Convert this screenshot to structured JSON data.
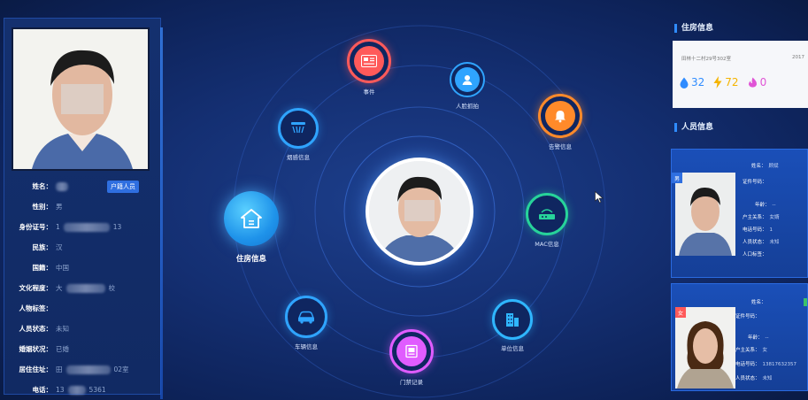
{
  "left_panel": {
    "tag_button": "户籍人员",
    "fields": [
      {
        "label": "姓名：",
        "value": "",
        "blurred": true,
        "has_tag": true
      },
      {
        "label": "性别：",
        "value": "男",
        "blurred": false
      },
      {
        "label": "身份证号：",
        "value_prefix": "1",
        "value_suffix": "13",
        "blurred": true
      },
      {
        "label": "民族：",
        "value": "汉",
        "blurred": false
      },
      {
        "label": "国籍：",
        "value": "中国",
        "blurred": false
      },
      {
        "label": "文化程度：",
        "value_prefix": "大",
        "value_suffix": "校",
        "blurred": true
      },
      {
        "label": "人物标签：",
        "value": "",
        "blurred": false
      },
      {
        "label": "人员状态：",
        "value": "未知",
        "blurred": false
      },
      {
        "label": "婚姻状况：",
        "value": "已婚",
        "blurred": false
      },
      {
        "label": "居住住址：",
        "value_prefix": "田",
        "value_suffix": "02室",
        "blurred": true
      },
      {
        "label": "电话：",
        "value_prefix": "13",
        "value_suffix": "5361",
        "blurred": true
      }
    ]
  },
  "nodes": {
    "event": "事件",
    "face": "人脸抓拍",
    "alert": "告警信息",
    "mac": "MAC信息",
    "unit": "单位信息",
    "access": "门禁记录",
    "vehicle": "车辆信息",
    "housing": "住房信息",
    "smoke": "烟感信息"
  },
  "right_panel": {
    "housing_title": "住房信息",
    "housing_address": "田林十二村29号302室",
    "housing_year": "2017",
    "stats": {
      "water": "32",
      "power": "72",
      "gas": "0"
    },
    "persons_title": "人员信息",
    "person1": {
      "gender_badge": "男",
      "name_label": "姓名：",
      "name_value": "顾斌",
      "id_label": "证件号码：",
      "age_label": "年龄：",
      "age_value": "--",
      "relation_label": "户主关系：",
      "relation_value": "女婿",
      "phone_label": "电话号码：",
      "phone_value": "1",
      "status_label": "人员状态：",
      "status_value": "未知",
      "tag_label": "人口标签："
    },
    "person2": {
      "gender_badge": "女",
      "name_label": "姓名：",
      "id_label": "证件号码：",
      "age_label": "年龄：",
      "age_value": "--",
      "relation_label": "户主关系：",
      "relation_value": "女",
      "phone_label": "电话号码：",
      "phone_value": "13817632357",
      "status_label": "人员状态：",
      "status_value": "未知"
    }
  },
  "colors": {
    "event": "#ff5a5a",
    "face": "#2fa4ff",
    "alert": "#ff8a2a",
    "mac": "#27d39a",
    "unit": "#2fb6ff",
    "access": "#e05cff",
    "vehicle": "#2fa4ff",
    "smoke": "#2fa4ff",
    "housing": "#1f93ea"
  }
}
